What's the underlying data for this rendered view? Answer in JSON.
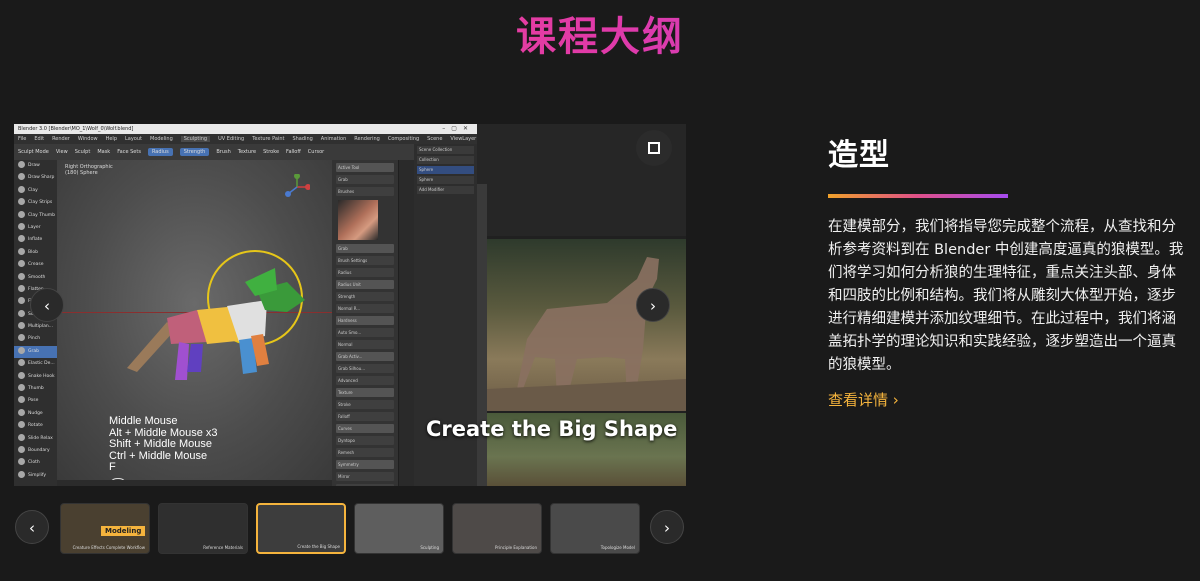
{
  "page": {
    "title": "课程大纲"
  },
  "blender": {
    "window_title": "Blender 3.0 [Blender\\MO_1\\Wolf_0\\Wolf.blend]",
    "menu": [
      "File",
      "Edit",
      "Render",
      "Window",
      "Help",
      "Layout",
      "Modeling",
      "Sculpting",
      "UV Editing",
      "Texture Paint",
      "Shading",
      "Animation",
      "Rendering",
      "Compositing",
      "Scene",
      "ViewLayer"
    ],
    "active_workspace": "Sculpting",
    "header_items": [
      "Sculpt Mode",
      "View",
      "Sculpt",
      "Mask",
      "Face Sets",
      "Radius",
      "Strength",
      "Brush",
      "Texture",
      "Stroke",
      "Falloff",
      "Cursor"
    ],
    "viewport_label_line1": "Right Orthographic",
    "viewport_label_line2": "(180) Sphere",
    "brushes": [
      "Draw",
      "Draw Sharp",
      "Clay",
      "Clay Strips",
      "Clay Thumb",
      "Layer",
      "Inflate",
      "Blob",
      "Crease",
      "Smooth",
      "Flatten",
      "Fill",
      "Scrape",
      "Multiplan...",
      "Pinch",
      "Grab",
      "Elastic De...",
      "Snake Hook",
      "Thumb",
      "Pose",
      "Nudge",
      "Rotate",
      "Slide Relax",
      "Boundary",
      "Cloth",
      "Simplify"
    ],
    "selected_brush": "Grab",
    "props": [
      "Active Tool",
      "Grab",
      "Brushes",
      "Grab",
      "Brush Settings",
      "Radius",
      "Radius Unit",
      "Strength",
      "Normal R...",
      "Hardness",
      "Auto Smo...",
      "Normal",
      "Grab Activ...",
      "Grab Silhou...",
      "Advanced",
      "Texture",
      "Stroke",
      "Falloff",
      "Curves",
      "Dyntopo",
      "Remesh",
      "Symmetry",
      "Mirror",
      "Lock",
      "Tiling",
      "Feather",
      "Radial X",
      "Radial Y",
      "Radial Z"
    ],
    "outliner": [
      "Scene Collection",
      "Collection",
      "Sphere",
      "Sphere",
      "Add Modifier"
    ],
    "shortcuts": [
      "Middle Mouse",
      "Alt + Middle Mouse x3",
      "Shift + Middle Mouse",
      "Ctrl + Middle Mouse",
      "F"
    ],
    "frame_counter": "310"
  },
  "slide": {
    "caption": "Create the Big Shape"
  },
  "thumbnails": [
    {
      "label": "Creature Effects Complete Workflow",
      "tag": "Modeling",
      "active": false,
      "color": "#4a4030"
    },
    {
      "label": "Reference Materials",
      "tag": "",
      "active": false,
      "color": "#2f2f2f"
    },
    {
      "label": "Create the Big Shape",
      "tag": "",
      "active": true,
      "color": "#3d3d3d"
    },
    {
      "label": "Sculpting",
      "tag": "",
      "active": false,
      "color": "#5e5e5e"
    },
    {
      "label": "Principle Explanation",
      "tag": "",
      "active": false,
      "color": "#4e4a48"
    },
    {
      "label": "Topologize Model",
      "tag": "",
      "active": false,
      "color": "#4a4a4a"
    }
  ],
  "section": {
    "title": "造型",
    "description": "在建模部分，我们将指导您完成整个流程，从查找和分析参考资料到在 Blender 中创建高度逼真的狼模型。我们将学习如何分析狼的生理特征，重点关注头部、身体和四肢的比例和结构。我们将从雕刻大体型开始，逐步进行精细建模并添加纹理细节。在此过程中，我们将涵盖拓扑学的理论知识和实践经验，逐步塑造出一个逼真的狼模型。",
    "more_label": "查看详情 ›"
  },
  "icons": {
    "prev": "‹",
    "next": "›"
  },
  "colors": {
    "accent": "#f5b43d",
    "title_gradient": [
      "#ff4f7d",
      "#b648e6"
    ],
    "blender_blue": "#4772b3"
  }
}
